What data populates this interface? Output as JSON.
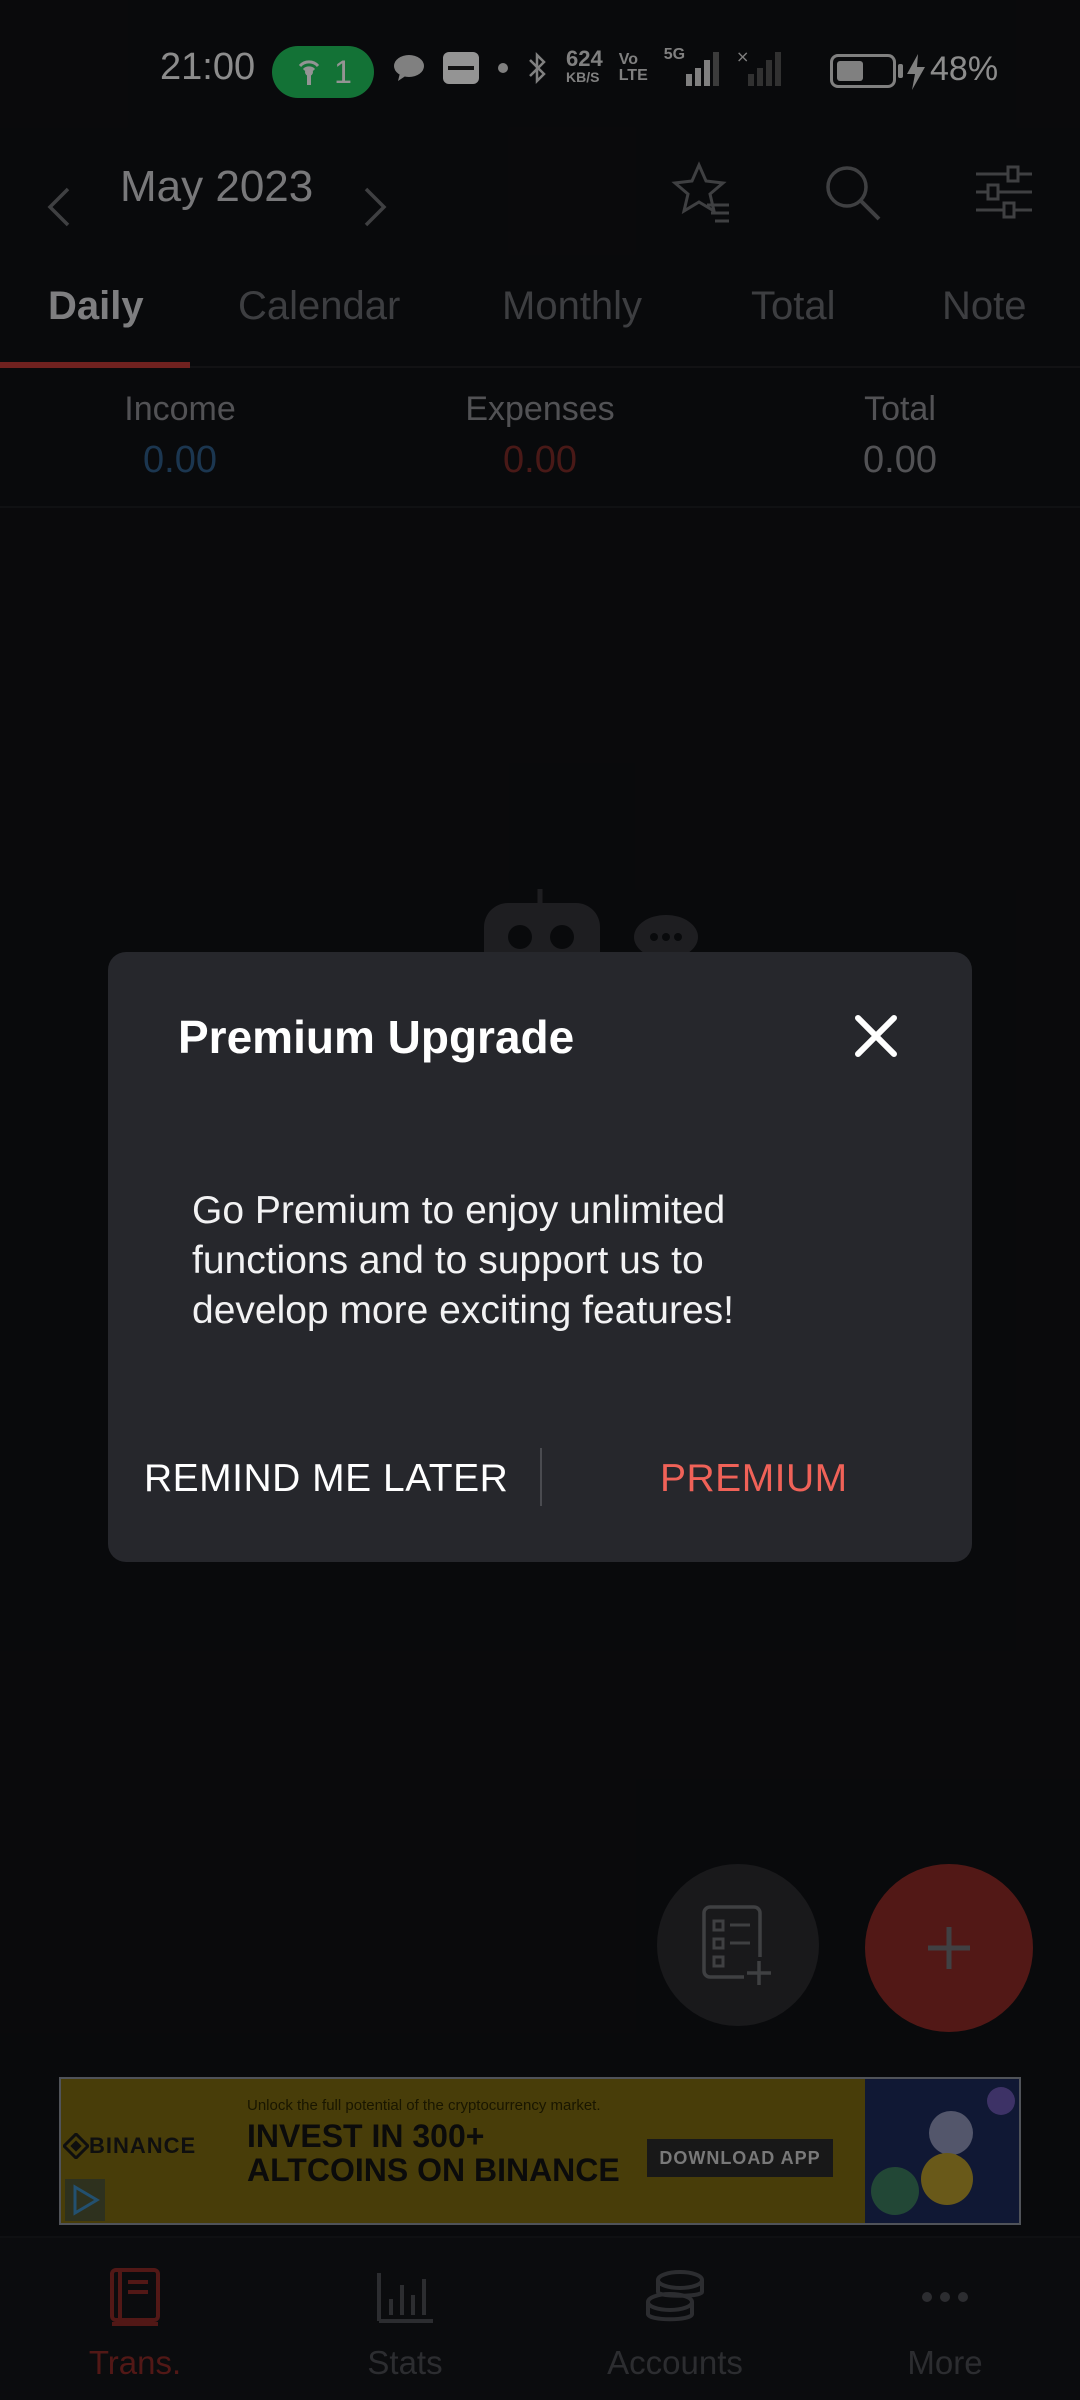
{
  "status_bar": {
    "time": "21:00",
    "hotspot_count": "1",
    "speed_value": "624",
    "speed_unit": "KB/S",
    "volte_line1": "Vo",
    "volte_line2": "LTE",
    "network": "5G",
    "battery": "48%"
  },
  "header": {
    "month": "May 2023"
  },
  "tabs": [
    "Daily",
    "Calendar",
    "Monthly",
    "Total",
    "Note"
  ],
  "summary": {
    "income_label": "Income",
    "income_value": "0.00",
    "expenses_label": "Expenses",
    "expenses_value": "0.00",
    "total_label": "Total",
    "total_value": "0.00"
  },
  "dialog": {
    "title": "Premium Upgrade",
    "body": "Go Premium to enjoy unlimited functions and to support us to develop more exciting features!",
    "later_label": "REMIND ME LATER",
    "premium_label": "PREMIUM"
  },
  "ad": {
    "brand": "BINANCE",
    "subtext": "Unlock the full potential of the cryptocurrency market.",
    "headline_line1": "INVEST IN 300+",
    "headline_line2": "ALTCOINS ON BINANCE",
    "cta": "DOWNLOAD APP"
  },
  "bottom_nav": [
    {
      "label": "Trans.",
      "icon": "book-icon"
    },
    {
      "label": "Stats",
      "icon": "bar-chart-icon"
    },
    {
      "label": "Accounts",
      "icon": "coins-icon"
    },
    {
      "label": "More",
      "icon": "more-dots-icon"
    }
  ],
  "colors": {
    "income": "#2f5d8a",
    "expenses": "#7e2b28",
    "accent": "#c23a36",
    "premium": "#f06258"
  }
}
